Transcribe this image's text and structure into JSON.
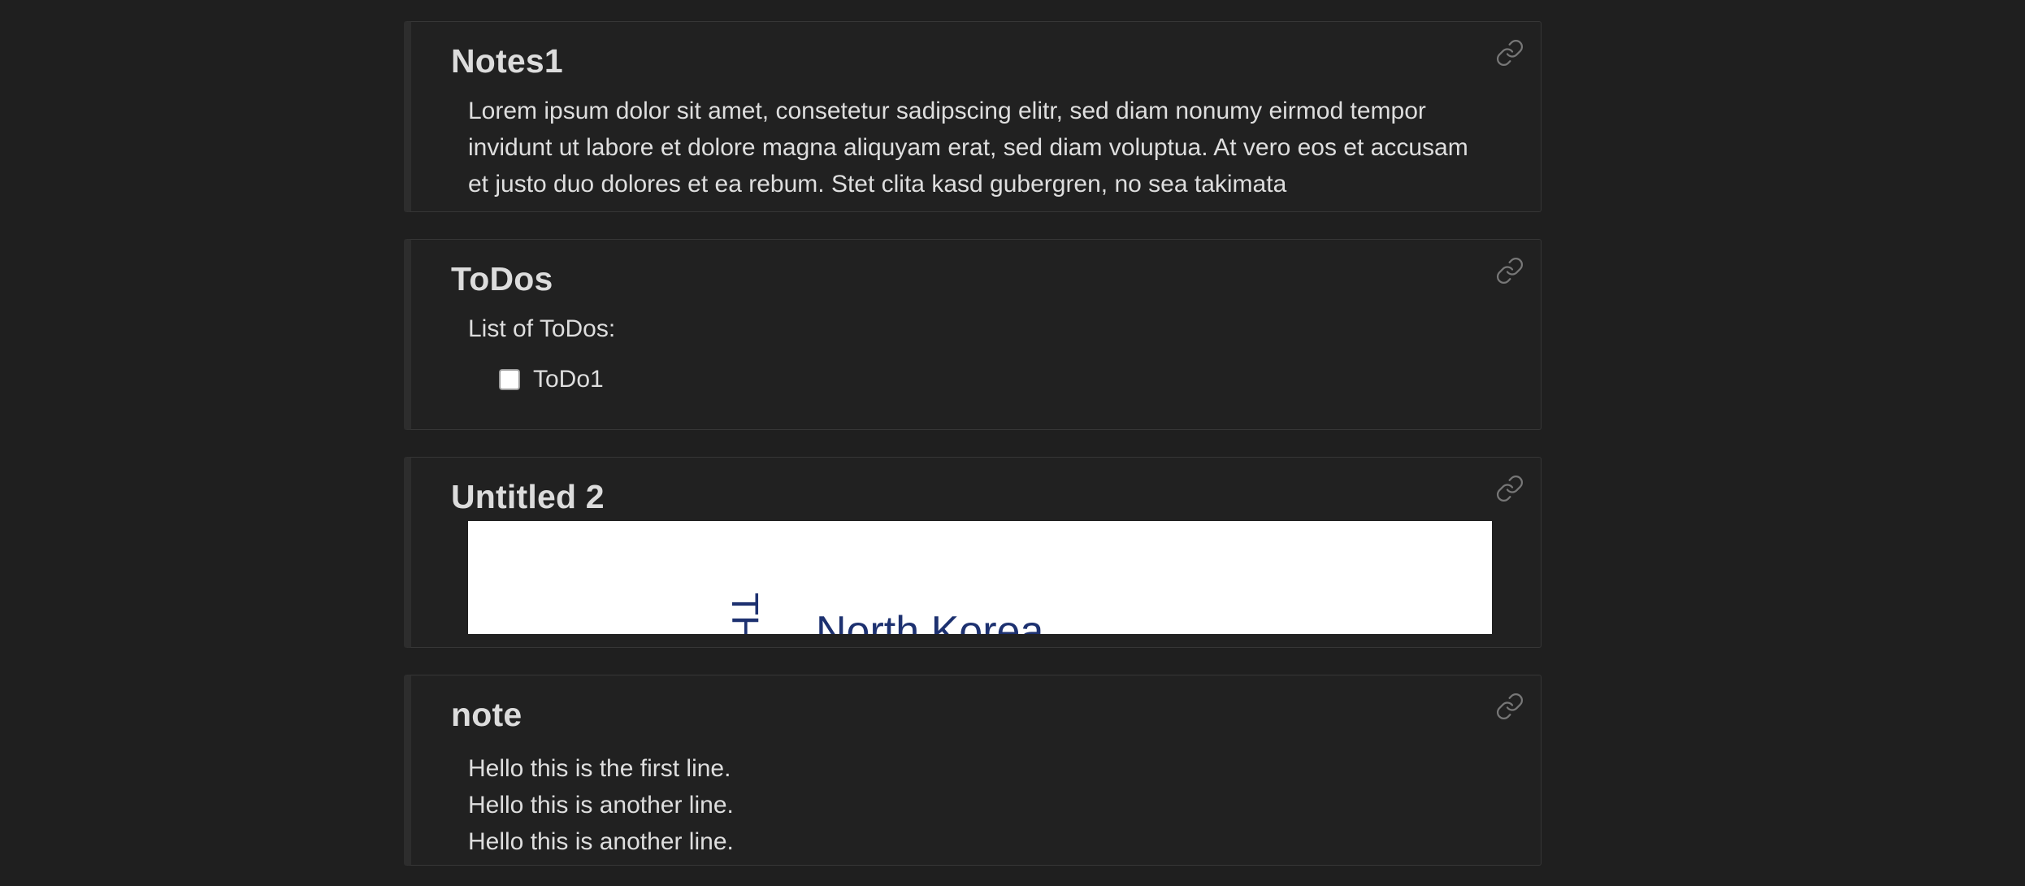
{
  "cards": [
    {
      "title": "Notes1",
      "body": "Lorem ipsum dolor sit amet, consetetur sadipscing elitr, sed diam nonumy eirmod tempor invidunt ut labore et dolore magna aliquyam erat, sed diam voluptua. At vero eos et accusam et justo duo dolores et ea rebum. Stet clita kasd gubergren, no sea takimata",
      "link_icon": "link-icon"
    },
    {
      "title": "ToDos",
      "intro": "List of ToDos:",
      "todos": [
        {
          "label": "ToDo1",
          "checked": false
        }
      ],
      "link_icon": "link-icon"
    },
    {
      "title": "Untitled 2",
      "embed": {
        "vertical_text": "TH",
        "label": "North Korea"
      },
      "link_icon": "link-icon"
    },
    {
      "title": "note",
      "lines": [
        "Hello this is the first line.",
        "Hello this is another line.",
        "Hello this is another line."
      ],
      "link_icon": "link-icon"
    }
  ],
  "colors": {
    "background": "#1f1f1f",
    "card_background": "#212121",
    "card_border": "#363636",
    "title_text": "#dcdcdc",
    "body_text": "#dedede",
    "embed_text": "#1d3170",
    "icon": "#777777"
  }
}
